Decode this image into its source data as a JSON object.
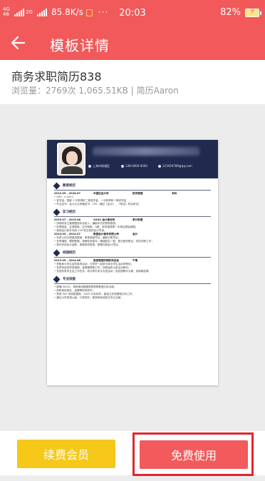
{
  "status_bar": {
    "network_top": "4G",
    "network_bottom": "46",
    "network2": "2G",
    "speed": "85.8K/s",
    "dots": "···",
    "time": "20:03",
    "battery": "82%"
  },
  "nav": {
    "title": "模板详情"
  },
  "template": {
    "title": "商务求职简历838",
    "meta": "浏览量：2769次 1,065.51KB | 简历Aaron"
  },
  "resume": {
    "contacts": [
      "上海市杨浦区",
      "138-0000-0000",
      "123456789@qq.com"
    ],
    "sections": [
      {
        "title": "教育经历",
        "entries": [
          {
            "date": "2013.09 – 2016.07",
            "org": "中国社会大学",
            "role": "财务管理",
            "extra": "本科",
            "bullets": [
              "GPA：3.9/4.0",
              "奖学金：国家 2 次获得校二等奖学金，一次获得校一等奖学金",
              "专业证书：会计从业资格证书、CPA（通过《会计》、《税法》科目考试）"
            ]
          }
        ]
      },
      {
        "title": "实习经历",
        "entries": [
          {
            "date": "2015.07 – 2015.08",
            "org": "XXXX 会计事务所",
            "role": "审计助理",
            "extra": "",
            "bullets": [
              "协助财务主管根据成本及收入，编制本月的预算报表；",
              "处理现金、应收账款，应付账款，Q账，财务报表等一手单位原始单据；",
              "使用会计软件完成 250 笔交易的会计凭录。"
            ]
          },
          {
            "date": "2014.03 – 2014.07",
            "org": "数据会计事务有限公司",
            "role": "会计",
            "extra": "",
            "bullets": [
              "负责公司日常费用报销，审核原始凭证，编制记账凭证；",
              "负责编制、跟踪数据，按期检查核对，确保账实一致，登记相关账目，完成对账工作；",
              "按月完成会计结账，填报财务报表，整理归档会计凭证。"
            ]
          }
        ]
      },
      {
        "title": "校园经历",
        "entries": [
          {
            "date": "2013.09 – 2014.06",
            "org": "旅游管理学院财务协会",
            "role": "干事",
            "extra": "",
            "bullets": [
              "积极参与学生会的各项活动，与同学一起参与商业学生活动的策划；",
              "负责协会的财务报销、经费管理等工作，协助组织大型活动两次；",
              "完成所有学生会工作任务，成功举办多次大型活动，如校园歌手大赛、迎新晚会等。"
            ]
          }
        ]
      },
      {
        "title": "专业技能",
        "entries": [
          {
            "date": "",
            "org": "",
            "role": "",
            "extra": "",
            "bullets": [
              "精通 EXCEL，熟练使用数据透视表等数据分析功能；",
              "熟练使用用友、金蝶等财务软件；",
              "熟悉 SAP 系统数据库，SASS 分析软件，能独立完成基础分析工作；",
              "通过大学英语六级，口语流利，能熟练阅读英文专业文献。"
            ]
          }
        ]
      }
    ]
  },
  "bottom": {
    "vip_label": "续费会员",
    "free_label": "免费使用"
  },
  "colors": {
    "brand_red": "#f1595a",
    "vip_yellow": "#f5c81a",
    "resume_navy": "#1f2a4e",
    "highlight": "#e3242b"
  }
}
